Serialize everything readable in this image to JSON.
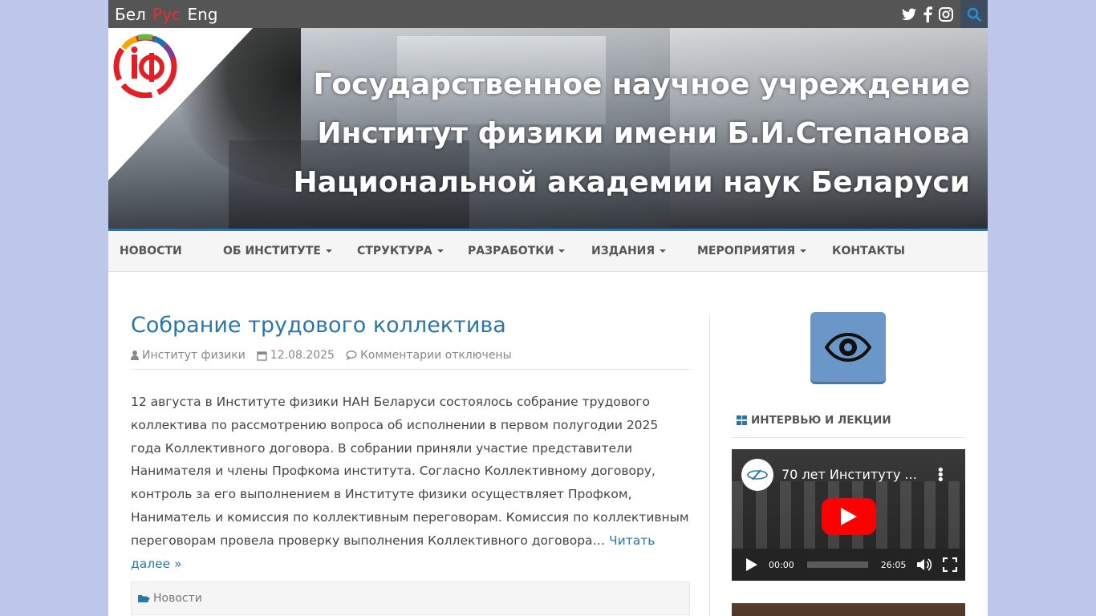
{
  "topbar": {
    "languages": [
      "Бел",
      "Рус",
      "Eng"
    ],
    "active_language": "Рус",
    "social_icons": [
      "twitter-icon",
      "facebook-icon",
      "instagram-icon"
    ],
    "search_icon": "search-icon"
  },
  "banner": {
    "title_lines": [
      "Государственное научное учреждение",
      "Институт физики имени Б.И.Степанова",
      "Национальной академии наук Беларуси"
    ]
  },
  "nav": {
    "items": [
      {
        "label": "НОВОСТИ",
        "has_dropdown": false
      },
      {
        "label": "ОБ ИНСТИТУТЕ",
        "has_dropdown": true
      },
      {
        "label": "СТРУКТУРА",
        "has_dropdown": true
      },
      {
        "label": "РАЗРАБОТКИ",
        "has_dropdown": true
      },
      {
        "label": "ИЗДАНИЯ",
        "has_dropdown": true
      },
      {
        "label": "МЕРОПРИЯТИЯ",
        "has_dropdown": true
      },
      {
        "label": "КОНТАКТЫ",
        "has_dropdown": false
      }
    ]
  },
  "post": {
    "title": "Собрание трудового коллектива",
    "author": "Институт физики",
    "date": "12.08.2025",
    "comments": "Комментарии отключены",
    "excerpt": "12 августа в Институте физики НАН Беларуси состоялось собрание трудового коллектива по рассмотрению вопроса об исполнении в первом полугодии 2025 года Коллективного договора. В собрании приняли участие представители Нанимателя и члены Профкома института. Согласно Коллективному договору, контроль за его выполнением в Институте физики осуществляет Профком, Наниматель и комиссия по коллективным переговорам. Комиссия по коллективным переговорам провела проверку выполнения Коллективного договора…",
    "read_more": "Читать далее »",
    "category": "Новости"
  },
  "sidebar": {
    "accessibility_icon": "eye-icon",
    "widget_title": "ИНТЕРВЬЮ И ЛЕКЦИИ",
    "video": {
      "title": "70 лет Институту ...",
      "time_current": "00:00",
      "time_total": "26:05"
    }
  },
  "colors": {
    "accent": "#2a76a9",
    "topbar": "#555555",
    "active_language": "#e53030",
    "background": "#bcc7e9"
  }
}
